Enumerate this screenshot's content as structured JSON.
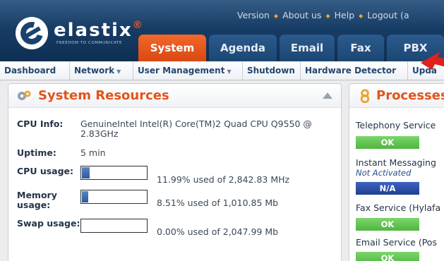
{
  "app": {
    "logo_text": "elastix",
    "tagline": "FREEDOM TO COMMUNICATE"
  },
  "top_links": [
    "Version",
    "About us",
    "Help",
    "Logout (a"
  ],
  "tabs": [
    {
      "label": "System",
      "active": true
    },
    {
      "label": "Agenda",
      "active": false
    },
    {
      "label": "Email",
      "active": false
    },
    {
      "label": "Fax",
      "active": false
    },
    {
      "label": "PBX",
      "active": false
    }
  ],
  "submenu": [
    {
      "label": "Dashboard",
      "has_caret": false
    },
    {
      "label": "Network",
      "has_caret": true
    },
    {
      "label": "User Management",
      "has_caret": true
    },
    {
      "label": "Shutdown",
      "has_caret": false
    },
    {
      "label": "Hardware Detector",
      "has_caret": false
    },
    {
      "label": "Upda",
      "has_caret": false
    }
  ],
  "system_resources": {
    "title": "System Resources",
    "cpu_info_label": "CPU Info:",
    "cpu_info_line1": "GenuineIntel Intel(R) Core(TM)2 Quad CPU Q9550 @",
    "cpu_info_line2": "2.83GHz",
    "uptime_label": "Uptime:",
    "uptime_value": "5 min",
    "cpu_usage": {
      "label": "CPU usage:",
      "fraction": 0.1199,
      "text": "11.99% used of 2,842.83 MHz"
    },
    "memory_usage": {
      "label_line1": "Memory",
      "label_line2": "usage:",
      "fraction": 0.0851,
      "text": "8.51% used of 1,010.85 Mb"
    },
    "swap_usage": {
      "label": "Swap usage:",
      "fraction": 0.0,
      "text": "0.00% used of 2,047.99 Mb"
    }
  },
  "processes": {
    "title": "Processes",
    "items": [
      {
        "name": "Telephony Service",
        "note": "",
        "status": "OK"
      },
      {
        "name": "Instant Messaging",
        "note": "Not Activated",
        "status": "N/A"
      },
      {
        "name": "Fax Service  (Hylafa",
        "note": "",
        "status": "OK"
      },
      {
        "name": "Email Service  (Pos",
        "note": "",
        "status": "OK"
      }
    ]
  },
  "colors": {
    "accent_orange": "#e2541b",
    "header_blue": "#173d66",
    "status_ok": "#4fb53e",
    "status_na": "#213f91"
  },
  "icons": {
    "system_resources_icon": "gears-icon",
    "processes_icon": "number-eight-icon",
    "collapse_icon": "triangle-up-icon",
    "pointer_icon": "red-arrow-icon"
  }
}
